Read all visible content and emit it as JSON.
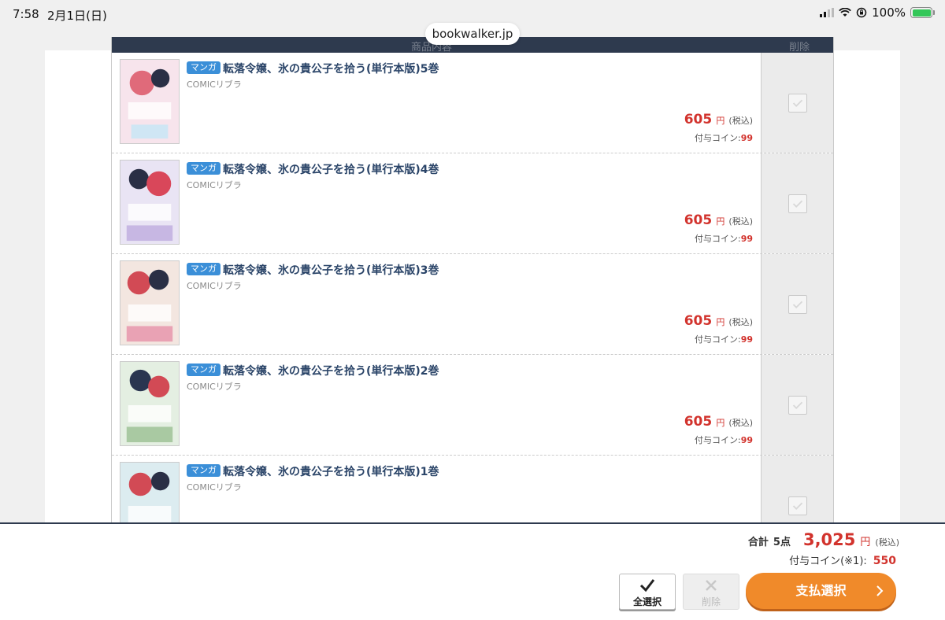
{
  "status_bar": {
    "time": "7:58",
    "date": "2月1日(日)",
    "battery_pct": "100%"
  },
  "browser": {
    "url": "bookwalker.jp"
  },
  "table": {
    "header_title": "商品内容",
    "header_delete": "削除"
  },
  "items": [
    {
      "badge": "マンガ",
      "title": "転落令嬢、氷の貴公子を拾う(単行本版)5巻",
      "publisher": "COMICリブラ",
      "price": "605",
      "price_unit": "円",
      "tax": "(税込)",
      "coin_label": "付与コイン:",
      "coin": "99",
      "checked": true
    },
    {
      "badge": "マンガ",
      "title": "転落令嬢、氷の貴公子を拾う(単行本版)4巻",
      "publisher": "COMICリブラ",
      "price": "605",
      "price_unit": "円",
      "tax": "(税込)",
      "coin_label": "付与コイン:",
      "coin": "99",
      "checked": true
    },
    {
      "badge": "マンガ",
      "title": "転落令嬢、氷の貴公子を拾う(単行本版)3巻",
      "publisher": "COMICリブラ",
      "price": "605",
      "price_unit": "円",
      "tax": "(税込)",
      "coin_label": "付与コイン:",
      "coin": "99",
      "checked": true
    },
    {
      "badge": "マンガ",
      "title": "転落令嬢、氷の貴公子を拾う(単行本版)2巻",
      "publisher": "COMICリブラ",
      "price": "605",
      "price_unit": "円",
      "tax": "(税込)",
      "coin_label": "付与コイン:",
      "coin": "99",
      "checked": true
    },
    {
      "badge": "マンガ",
      "title": "転落令嬢、氷の貴公子を拾う(単行本版)1巻",
      "publisher": "COMICリブラ",
      "price": "",
      "price_unit": "",
      "tax": "",
      "coin_label": "",
      "coin": "",
      "checked": true
    }
  ],
  "footer": {
    "total_label": "合計",
    "total_count": "5点",
    "total_price": "3,025",
    "total_unit": "円",
    "total_tax": "(税込)",
    "coin_label": "付与コイン(※1):",
    "coin_total": "550",
    "select_all_label": "全選択",
    "delete_label": "削除",
    "pay_label": "支払選択"
  },
  "colors": {
    "accent_orange": "#f08a2a",
    "price_red": "#d2332d",
    "header_navy": "#2e3a4e",
    "badge_blue": "#3b8fd8"
  }
}
